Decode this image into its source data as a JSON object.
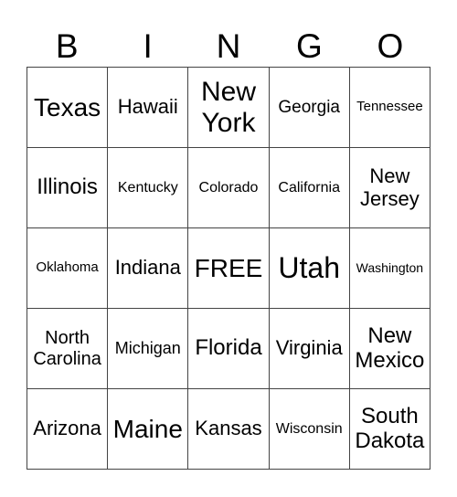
{
  "header": [
    "B",
    "I",
    "N",
    "G",
    "O"
  ],
  "cells": [
    [
      "Texas",
      "Hawaii",
      "New York",
      "Georgia",
      "Tennessee"
    ],
    [
      "Illinois",
      "Kentucky",
      "Colorado",
      "California",
      "New Jersey"
    ],
    [
      "Oklahoma",
      "Indiana",
      "FREE",
      "Utah",
      "Washington"
    ],
    [
      "North Carolina",
      "Michigan",
      "Florida",
      "Virginia",
      "New Mexico"
    ],
    [
      "Arizona",
      "Maine",
      "Kansas",
      "Wisconsin",
      "South Dakota"
    ]
  ]
}
